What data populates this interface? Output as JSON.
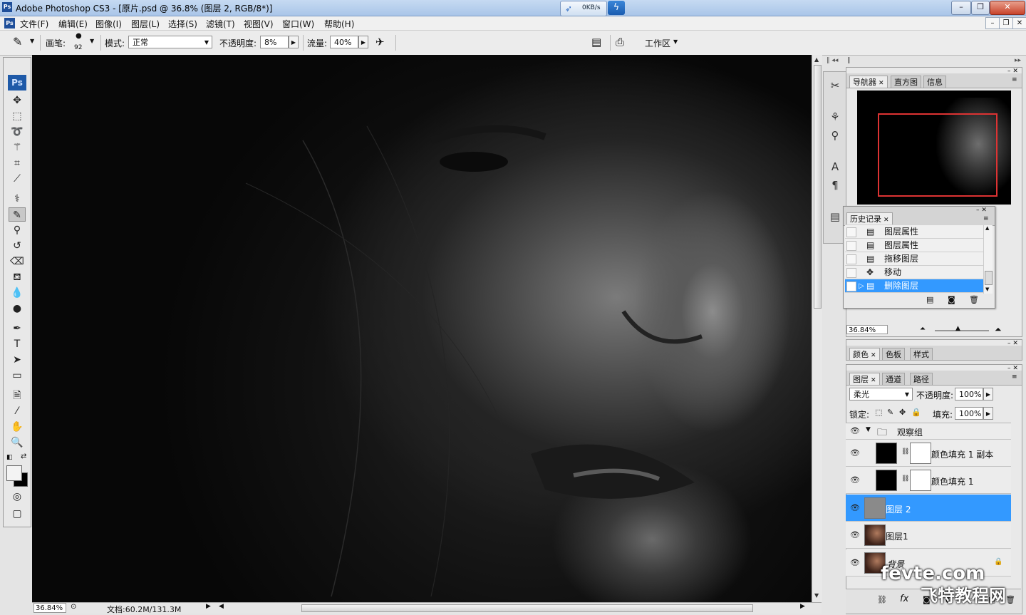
{
  "window": {
    "title": "Adobe Photoshop CS3 - [原片.psd @ 36.8% (图层 2, RGB/8*)]",
    "app_icon": "Ps",
    "speed": "0KB/s"
  },
  "menu": [
    "文件(F)",
    "编辑(E)",
    "图像(I)",
    "图层(L)",
    "选择(S)",
    "滤镜(T)",
    "视图(V)",
    "窗口(W)",
    "帮助(H)"
  ],
  "options": {
    "brush_label": "画笔:",
    "brush_size": "92",
    "mode_label": "模式:",
    "mode_value": "正常",
    "opacity_label": "不透明度:",
    "opacity_value": "8%",
    "flow_label": "流量:",
    "flow_value": "40%",
    "workspace": "工作区"
  },
  "toolbox": {
    "logo": "Ps"
  },
  "navigator": {
    "tabs": [
      "导航器",
      "直方图",
      "信息"
    ],
    "zoom": "36.84%"
  },
  "history": {
    "tab": "历史记录",
    "items": [
      {
        "label": "图层属性"
      },
      {
        "label": "图层属性"
      },
      {
        "label": "拖移图层"
      },
      {
        "label": "移动"
      },
      {
        "label": "删除图层"
      }
    ]
  },
  "color_panel": {
    "tabs": [
      "颜色",
      "色板",
      "样式"
    ]
  },
  "layers_panel": {
    "tabs": [
      "图层",
      "通道",
      "路径"
    ],
    "blend_mode": "柔光",
    "opacity_label": "不透明度:",
    "opacity_value": "100%",
    "lock_label": "锁定:",
    "fill_label": "填充:",
    "fill_value": "100%",
    "layers": [
      {
        "name": "观察组"
      },
      {
        "name": "颜色填充 1 副本"
      },
      {
        "name": "颜色填充 1"
      },
      {
        "name": "图层 2"
      },
      {
        "name": "图层1"
      },
      {
        "name": "背景"
      }
    ]
  },
  "status": {
    "zoom": "36.84%",
    "doc": "文档:60.2M/131.3M"
  },
  "watermark": [
    "fevte.com",
    "飞特教程网"
  ],
  "colors": {
    "selection": "#3399ff",
    "nav_rect": "#dd3333"
  }
}
